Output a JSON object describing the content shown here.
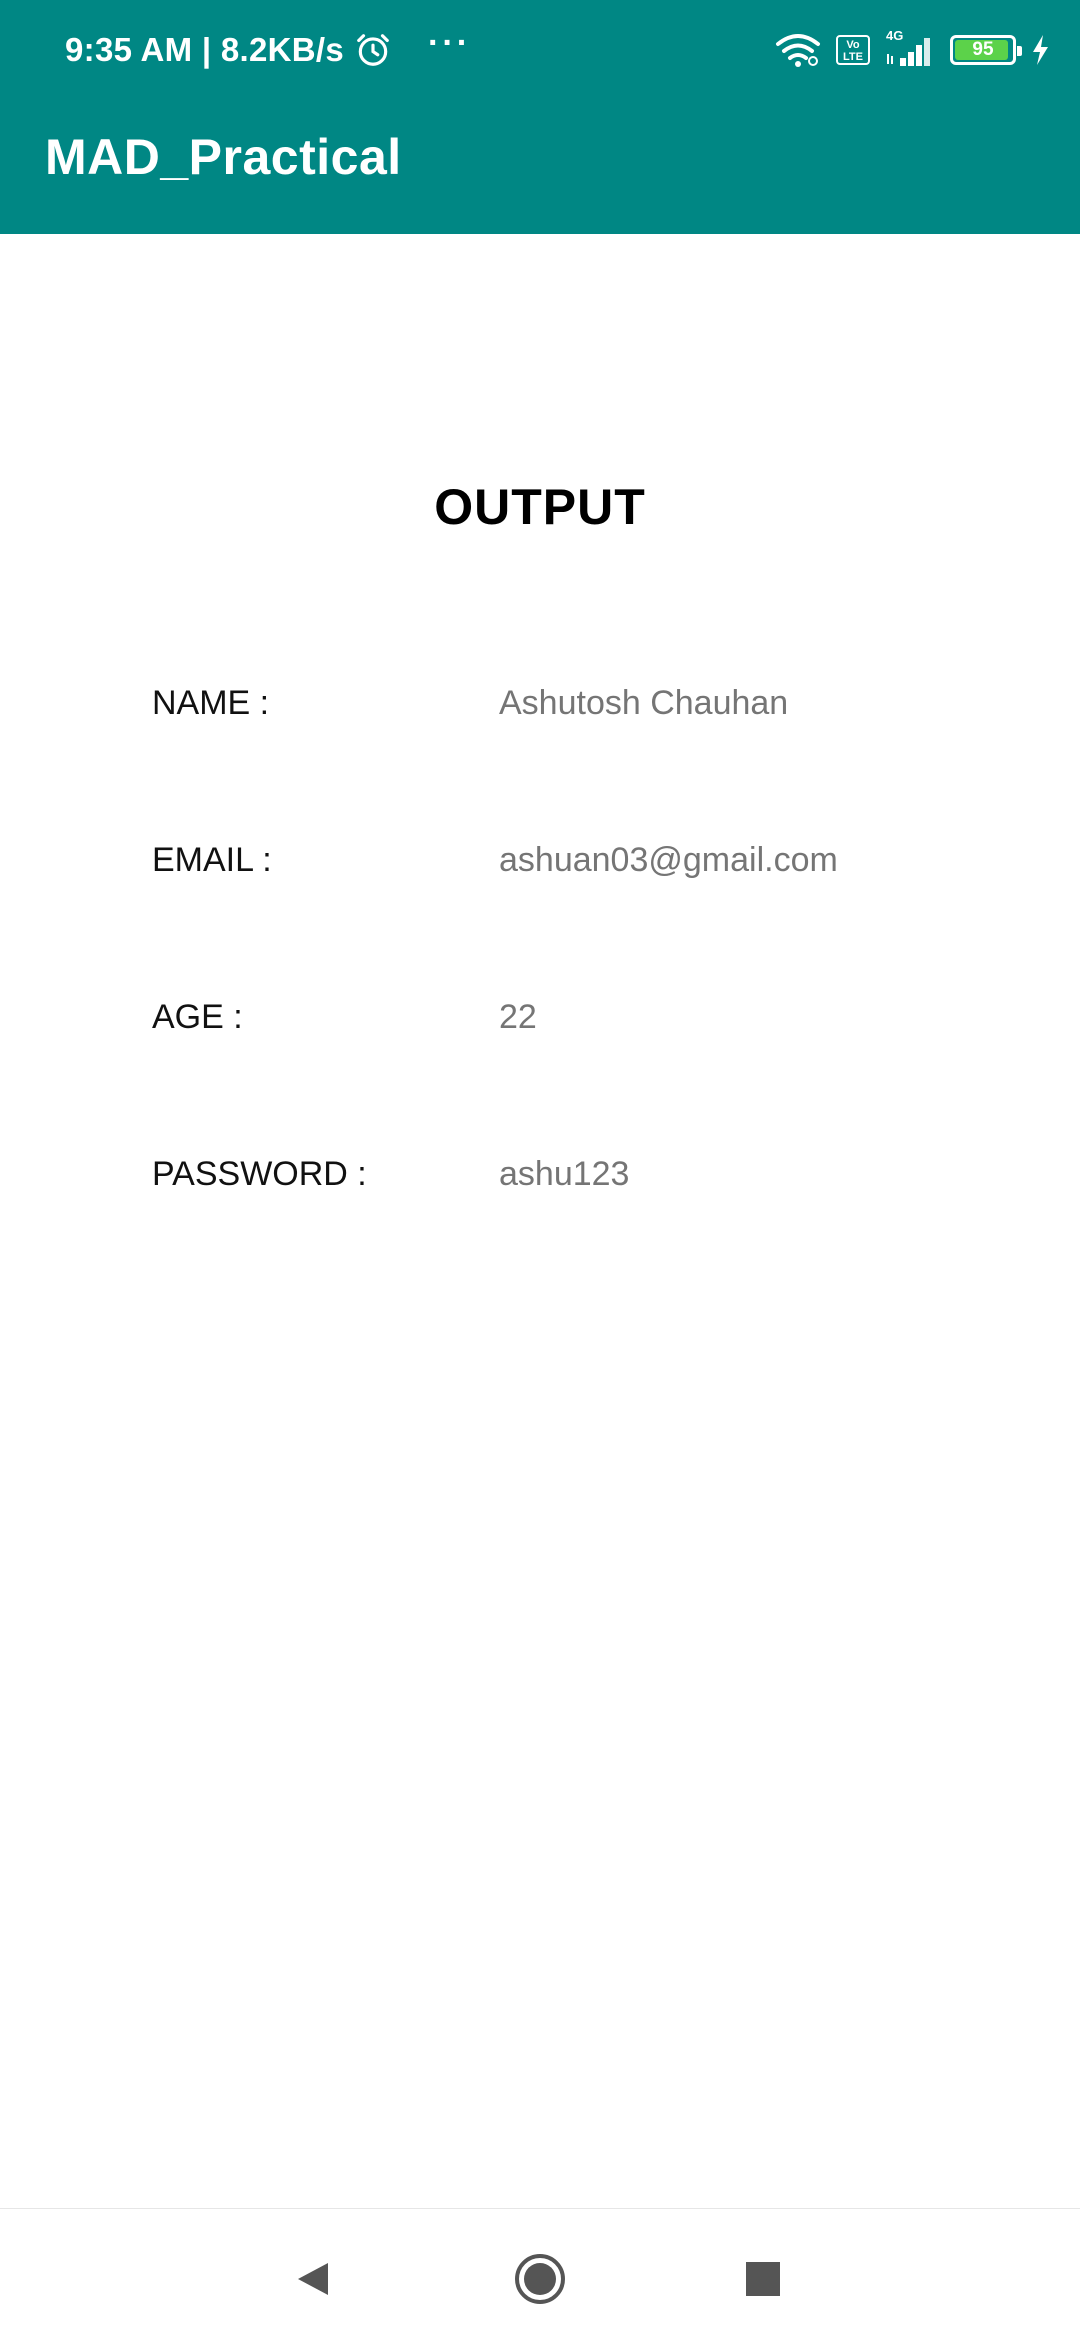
{
  "status_bar": {
    "time_and_speed": "9:35 AM | 8.2KB/s",
    "more_indicator": "···",
    "network_type": "4G",
    "volte_label": "Vo LTE",
    "battery_level": "95",
    "battery_fraction": 0.95,
    "icons": [
      "alarm-icon",
      "wifi-icon",
      "volte-icon",
      "signal-icon",
      "battery-icon",
      "charging-icon"
    ]
  },
  "app_bar": {
    "title": "MAD_Practical",
    "color": "#008784"
  },
  "content": {
    "heading": "OUTPUT",
    "fields": [
      {
        "label": "NAME :",
        "value": "Ashutosh Chauhan"
      },
      {
        "label": "EMAIL :",
        "value": "ashuan03@gmail.com"
      },
      {
        "label": "AGE :",
        "value": "22"
      },
      {
        "label": "PASSWORD :",
        "value": "ashu123"
      }
    ]
  },
  "nav_bar": {
    "buttons": [
      "back-icon",
      "home-icon",
      "recents-icon"
    ]
  }
}
